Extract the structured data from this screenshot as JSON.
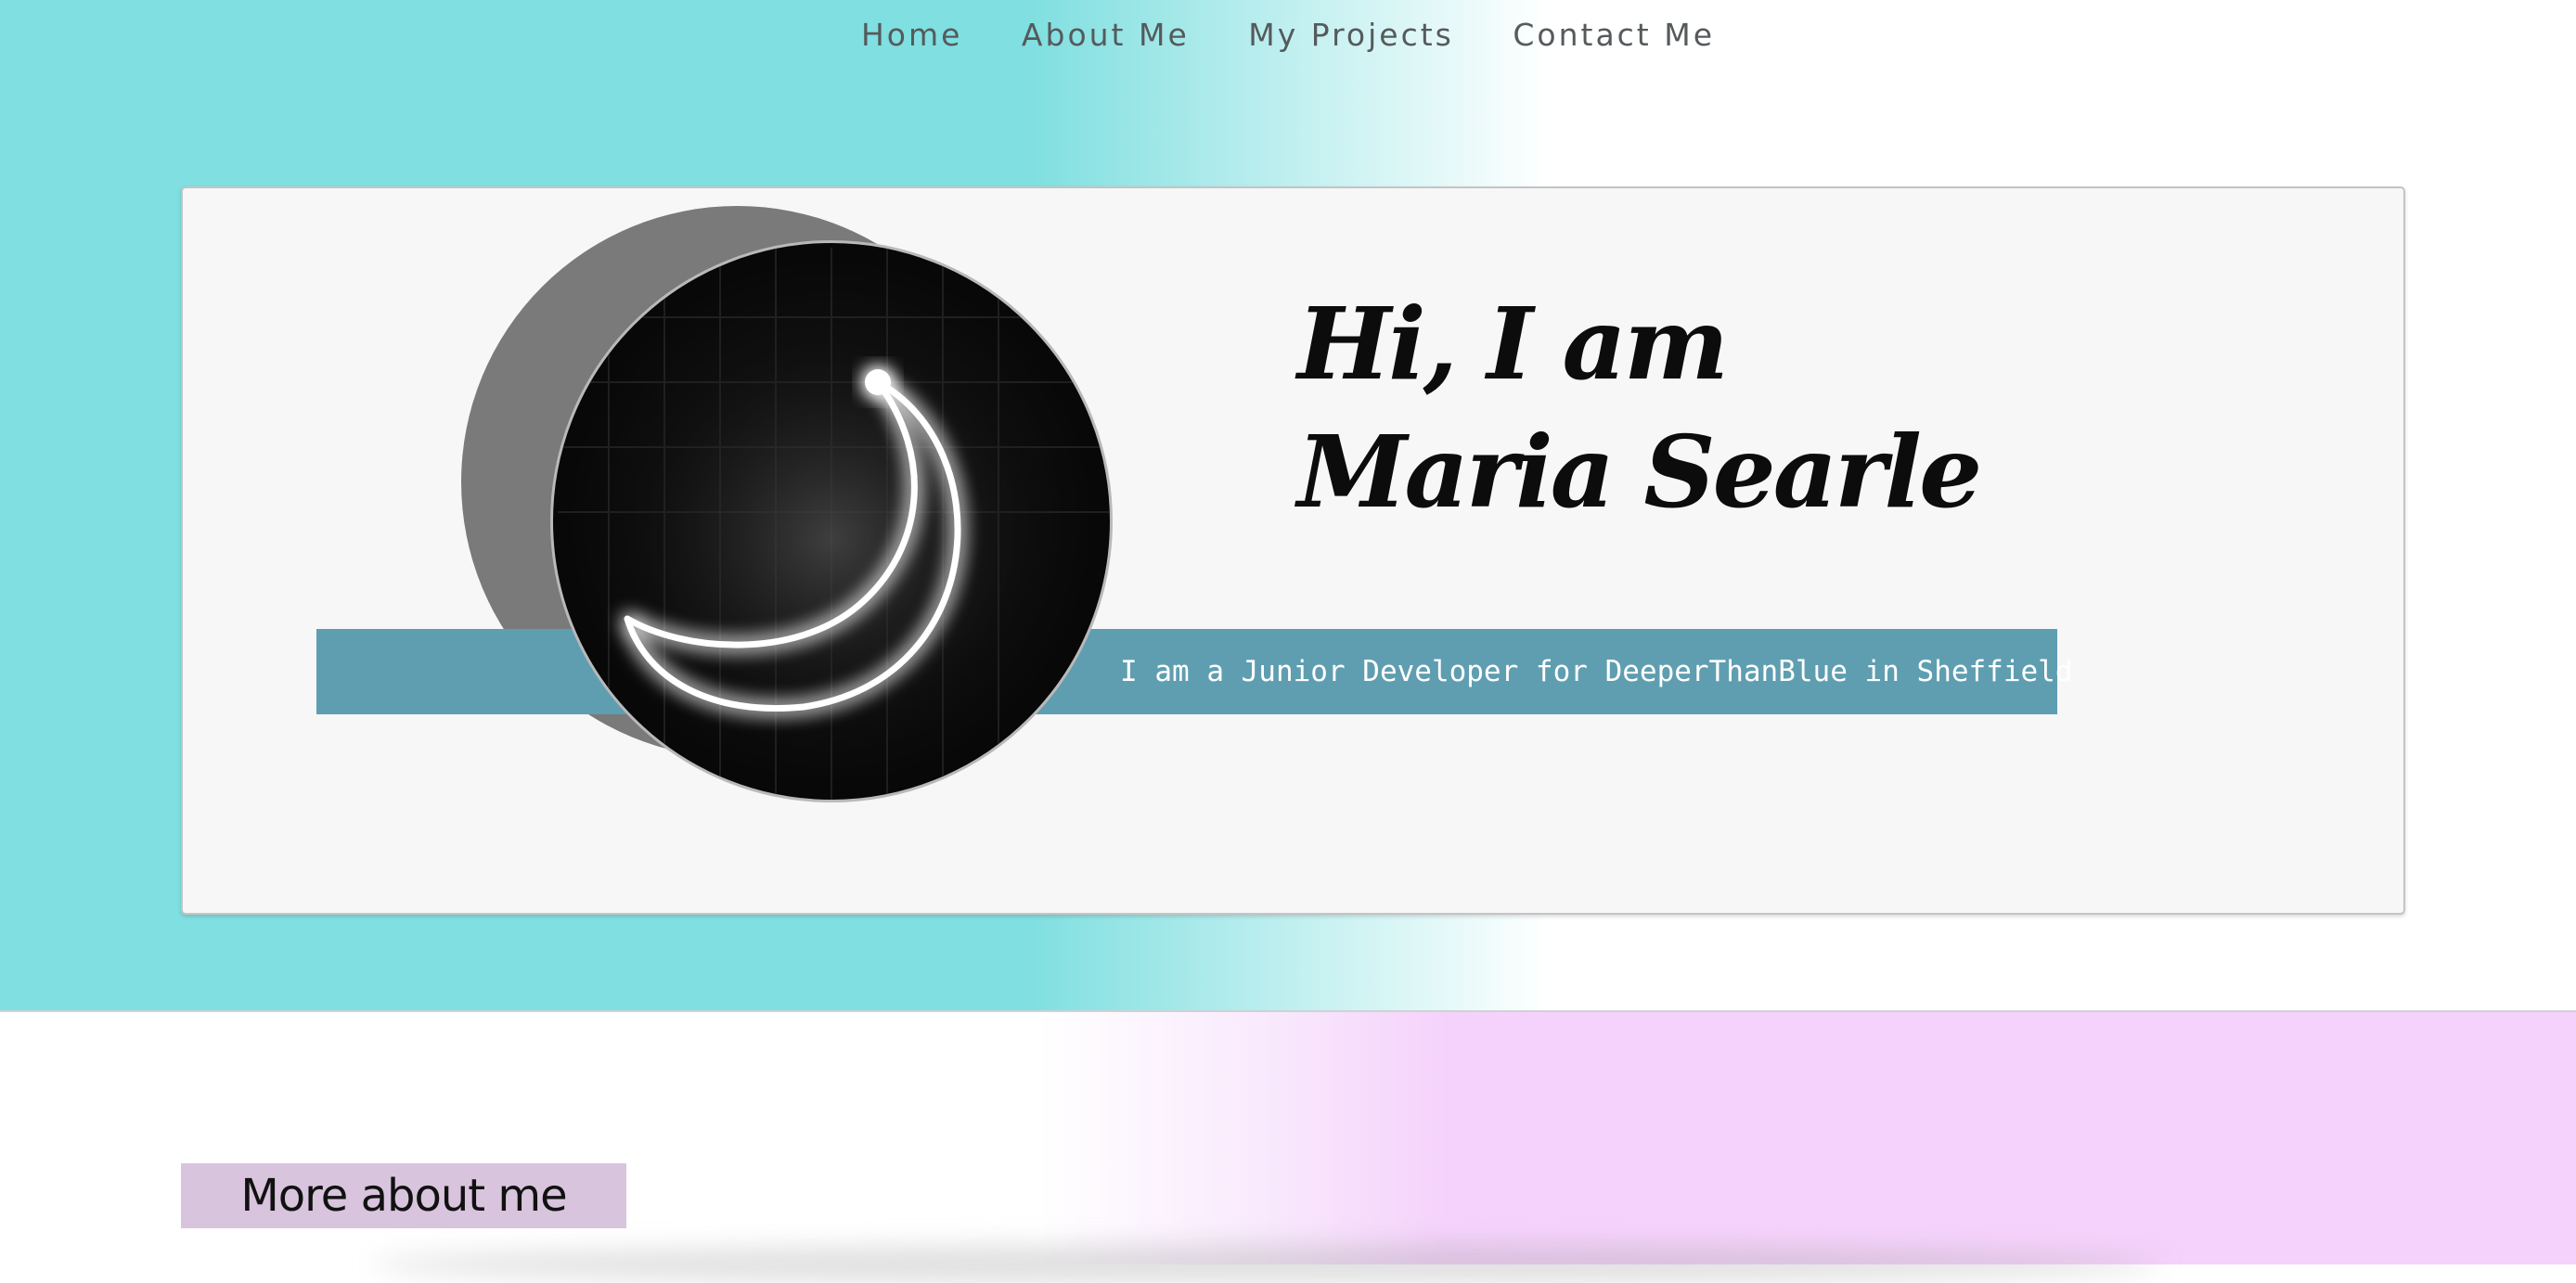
{
  "nav": {
    "items": [
      {
        "label": "Home"
      },
      {
        "label": "About Me"
      },
      {
        "label": "My Projects"
      },
      {
        "label": "Contact Me"
      }
    ]
  },
  "hero": {
    "heading_line1": "Hi, I am",
    "heading_line2": "Maria Searle",
    "tagline": "I am a Junior Developer for DeeperThanBlue in Sheffield",
    "portrait_icon": "crescent-moon-neon-icon"
  },
  "about": {
    "section_title": "More about me"
  },
  "colors": {
    "hero_teal": "#80dfe0",
    "banner_blue": "#5f9eb1",
    "card_bg": "#f7f7f7",
    "lower_pink": "#f5d2fb",
    "about_label_bg": "#d8c4dd"
  }
}
